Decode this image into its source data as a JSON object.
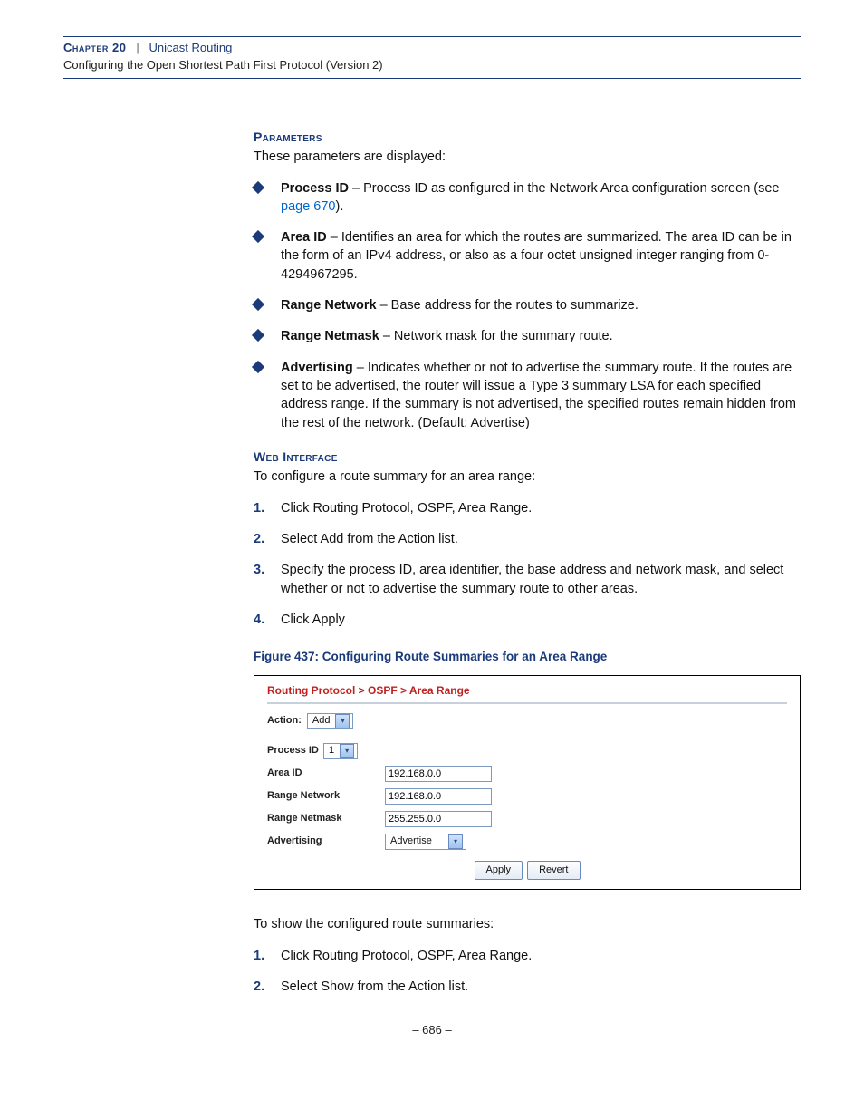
{
  "header": {
    "chapter_label": "Chapter 20",
    "separator": "|",
    "chapter_title": "Unicast Routing",
    "subtitle": "Configuring the Open Shortest Path First Protocol (Version 2)"
  },
  "sections": {
    "parameters_heading": "Parameters",
    "parameters_intro": "These parameters are displayed:",
    "web_heading": "Web Interface",
    "web_intro": "To configure a route summary for an area range:",
    "show_intro": "To show the configured route summaries:"
  },
  "bullets": [
    {
      "term": "Process ID",
      "desc_a": " – Process ID as configured in the Network Area configuration screen (see ",
      "link": "page 670",
      "desc_b": ")."
    },
    {
      "term": "Area ID",
      "desc_a": " – Identifies an area for which the routes are summarized. The area ID can be in the form of an IPv4 address, or also as a four octet unsigned integer ranging from 0-4294967295.",
      "link": "",
      "desc_b": ""
    },
    {
      "term": "Range Network",
      "desc_a": " – Base address for the routes to summarize.",
      "link": "",
      "desc_b": ""
    },
    {
      "term": "Range Netmask",
      "desc_a": " – Network mask for the summary route.",
      "link": "",
      "desc_b": ""
    },
    {
      "term": "Advertising",
      "desc_a": " – Indicates whether or not to advertise the summary route. If the routes are set to be advertised, the router will issue a Type 3 summary LSA for each specified address range. If the summary is not advertised, the specified routes remain hidden from the rest of the network. (Default: Advertise)",
      "link": "",
      "desc_b": ""
    }
  ],
  "steps_configure": [
    "Click Routing Protocol, OSPF, Area Range.",
    "Select Add from the Action list.",
    "Specify the process ID, area identifier, the base address and network mask, and select whether or not to advertise the summary route to other areas.",
    "Click Apply"
  ],
  "steps_show": [
    "Click Routing Protocol, OSPF, Area Range.",
    "Select Show from the Action list."
  ],
  "figure": {
    "caption": "Figure 437:  Configuring Route Summaries for an Area Range",
    "breadcrumb": "Routing Protocol > OSPF > Area Range",
    "action_label": "Action:",
    "action_value": "Add",
    "fields": {
      "process_id_label": "Process ID",
      "process_id_value": "1",
      "area_id_label": "Area ID",
      "area_id_value": "192.168.0.0",
      "range_network_label": "Range Network",
      "range_network_value": "192.168.0.0",
      "range_netmask_label": "Range Netmask",
      "range_netmask_value": "255.255.0.0",
      "advertising_label": "Advertising",
      "advertising_value": "Advertise"
    },
    "buttons": {
      "apply": "Apply",
      "revert": "Revert"
    }
  },
  "page_number": "–  686  –"
}
